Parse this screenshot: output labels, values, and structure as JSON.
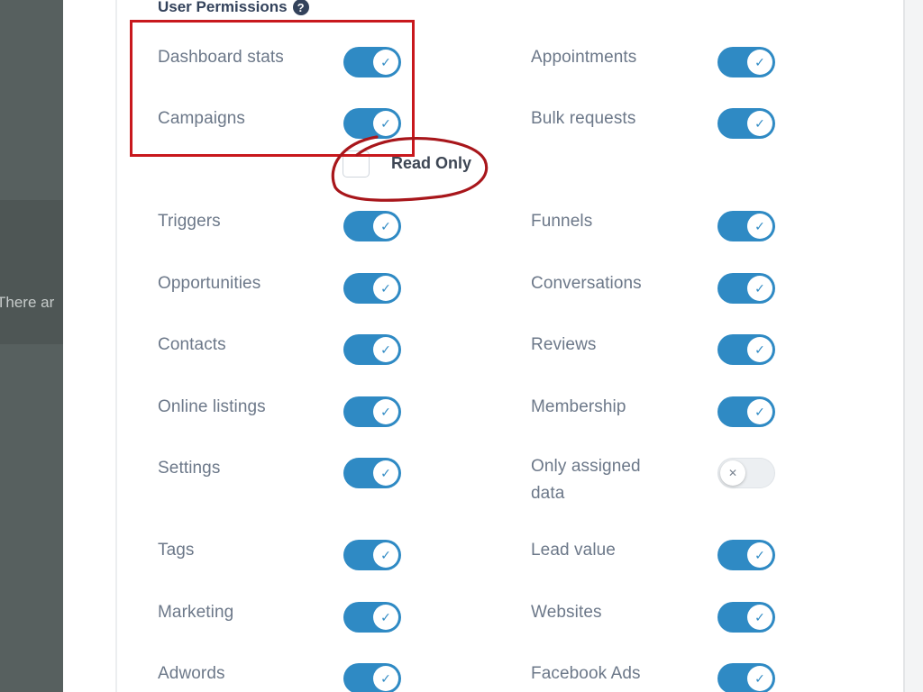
{
  "background": {
    "truncated_text": "There ar"
  },
  "section": {
    "title": "User Permissions",
    "help_icon": "question-circle-icon"
  },
  "colors": {
    "toggle_on": "#2f8ac4",
    "annotation": "#c8181d",
    "label_text": "#6c7889"
  },
  "read_only": {
    "label": "Read Only",
    "checked": false
  },
  "permissions_left": [
    {
      "label": "Dashboard stats",
      "enabled": true
    },
    {
      "label": "Campaigns",
      "enabled": true
    },
    {
      "label": "Triggers",
      "enabled": true
    },
    {
      "label": "Opportunities",
      "enabled": true
    },
    {
      "label": "Contacts",
      "enabled": true
    },
    {
      "label": "Online listings",
      "enabled": true
    },
    {
      "label": "Settings",
      "enabled": true
    },
    {
      "label": "Tags",
      "enabled": true
    },
    {
      "label": "Marketing",
      "enabled": true
    },
    {
      "label": "Adwords",
      "enabled": true
    }
  ],
  "permissions_right": [
    {
      "label": "Appointments",
      "enabled": true
    },
    {
      "label": "Bulk requests",
      "enabled": true
    },
    {
      "label": "Funnels",
      "enabled": true
    },
    {
      "label": "Conversations",
      "enabled": true
    },
    {
      "label": "Reviews",
      "enabled": true
    },
    {
      "label": "Membership",
      "enabled": true
    },
    {
      "label": "Only assigned data",
      "enabled": false
    },
    {
      "label": "Lead value",
      "enabled": true
    },
    {
      "label": "Websites",
      "enabled": true
    },
    {
      "label": "Facebook Ads",
      "enabled": true
    }
  ],
  "icons": {
    "toggle_on_glyph": "✓",
    "toggle_off_glyph": "✕"
  }
}
